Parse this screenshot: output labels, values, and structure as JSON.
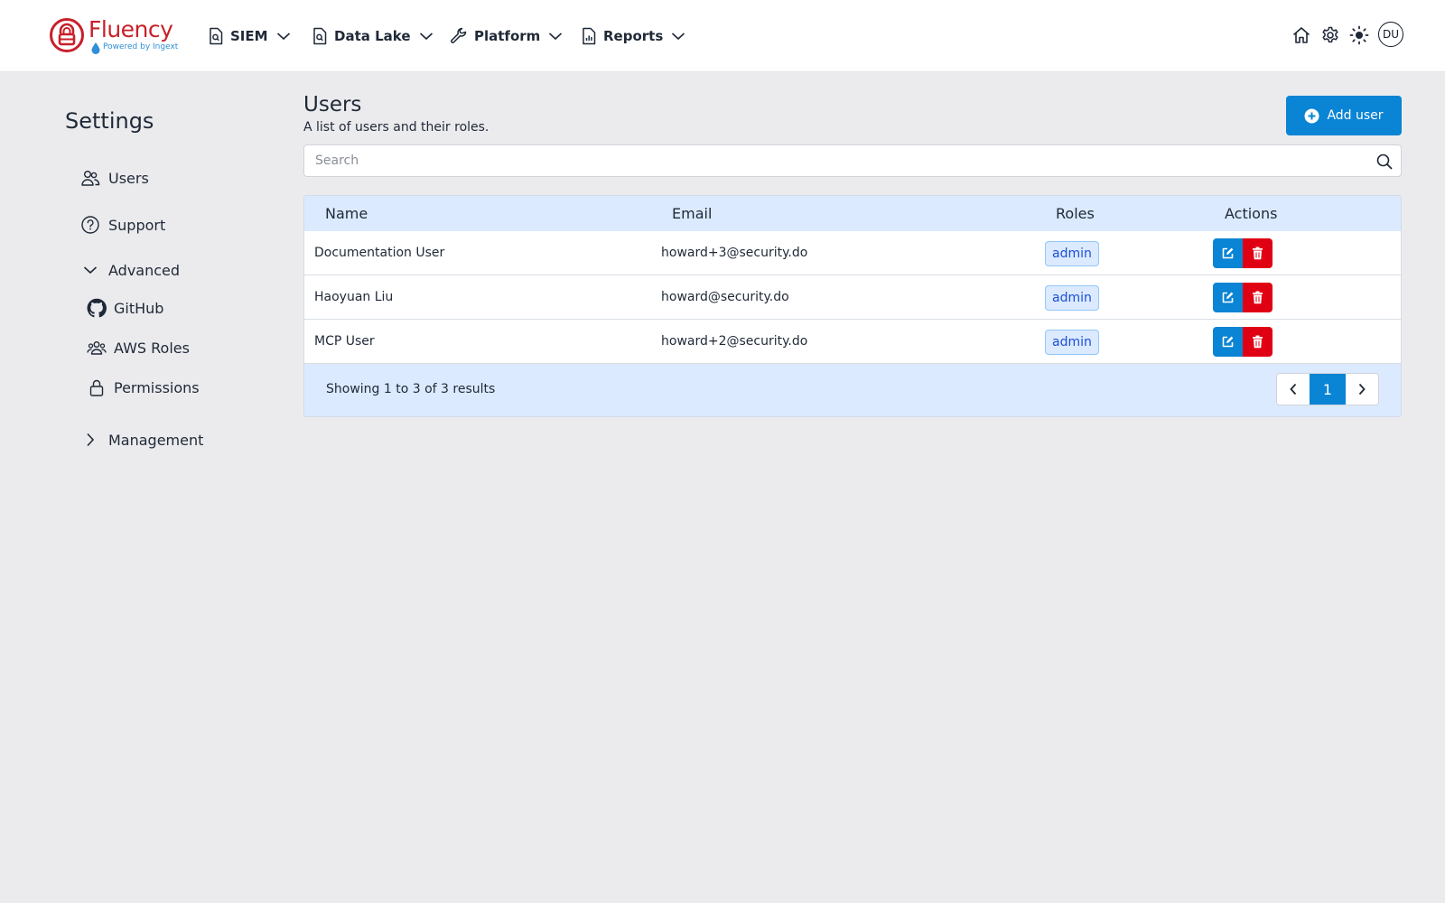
{
  "brand": {
    "name": "Fluency",
    "tagline": "Powered by Ingext",
    "color": "#c8202a"
  },
  "nav": {
    "items": [
      {
        "label": "SIEM",
        "icon": "search-document-icon"
      },
      {
        "label": "Data Lake",
        "icon": "search-document-icon"
      },
      {
        "label": "Platform",
        "icon": "wrench-icon"
      },
      {
        "label": "Reports",
        "icon": "chart-document-icon"
      }
    ],
    "right_icons": [
      "home-icon",
      "gear-icon",
      "sun-icon"
    ],
    "avatar_initials": "DU"
  },
  "sidebar": {
    "title": "Settings",
    "items": [
      {
        "label": "Users",
        "icon": "users-icon"
      },
      {
        "label": "Support",
        "icon": "question-circle-icon"
      },
      {
        "label": "Advanced",
        "icon": "chevron-down-icon",
        "expanded": true
      },
      {
        "label": "GitHub",
        "icon": "github-icon"
      },
      {
        "label": "AWS Roles",
        "icon": "user-group-icon"
      },
      {
        "label": "Permissions",
        "icon": "lock-icon"
      },
      {
        "label": "Management",
        "icon": "chevron-right-icon",
        "expanded": false
      }
    ]
  },
  "main": {
    "title": "Users",
    "subtitle": "A list of users and their roles.",
    "add_button_label": "Add user",
    "search_placeholder": "Search",
    "search_value": "",
    "accent": "#0a84d4",
    "danger": "#e00014",
    "table": {
      "columns": [
        "Name",
        "Email",
        "Roles",
        "Actions"
      ],
      "rows": [
        {
          "name": "Documentation User",
          "email": "howard+3@security.do",
          "role": "admin"
        },
        {
          "name": "Haoyuan Liu",
          "email": "howard@security.do",
          "role": "admin"
        },
        {
          "name": "MCP User",
          "email": "howard+2@security.do",
          "role": "admin"
        }
      ]
    },
    "footer": {
      "results_text": "Showing 1 to 3 of 3 results",
      "current_page": "1"
    }
  }
}
